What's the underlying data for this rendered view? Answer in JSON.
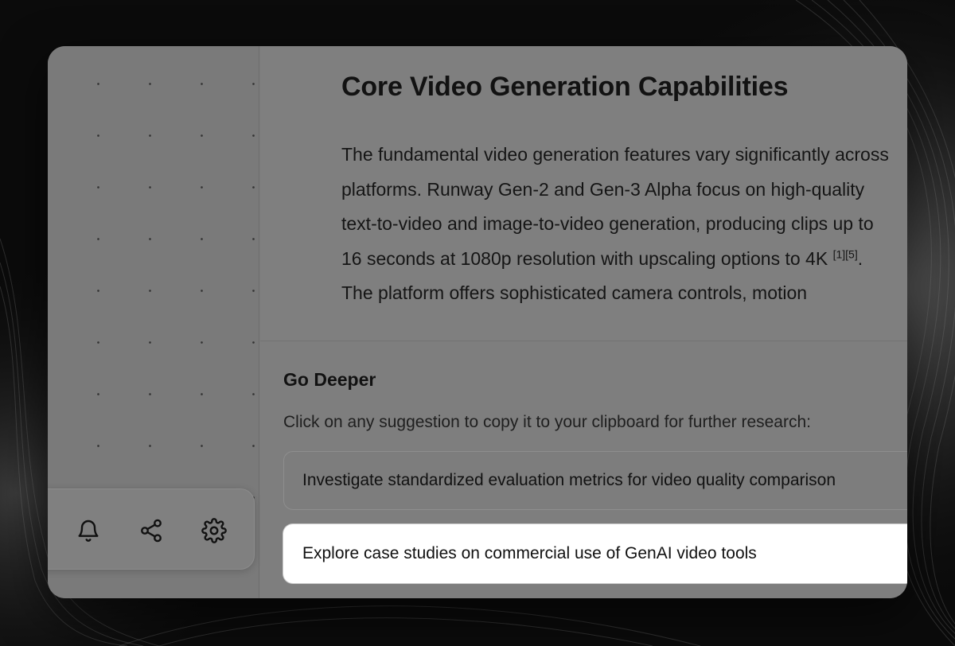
{
  "article": {
    "title": "Core Video Generation Capabilities",
    "body_text": "The fundamental video generation features vary significantly across platforms. Runway Gen-2 and Gen-3 Alpha focus on high-quality text-to-video and image-to-video generation, producing clips up to 16 seconds at 1080p resolution with upscaling options to 4K",
    "citations": "[1][5]",
    "body_text_after": ". The platform offers sophisticated camera controls, motion"
  },
  "go_deeper": {
    "title": "Go Deeper",
    "hint": "Click on any suggestion to copy it to your clipboard for further research:",
    "suggestions": [
      {
        "label": "Investigate standardized evaluation metrics for video quality comparison"
      },
      {
        "label": "Explore case studies on commercial use of GenAI video tools"
      }
    ]
  },
  "dock": {
    "icons": [
      "bell-icon",
      "share-icon",
      "gear-icon"
    ]
  },
  "colors": {
    "overlay": "#7d7d7d",
    "text": "#121212",
    "highlight": "#ffffff",
    "backdrop": "#0b0b0b"
  }
}
